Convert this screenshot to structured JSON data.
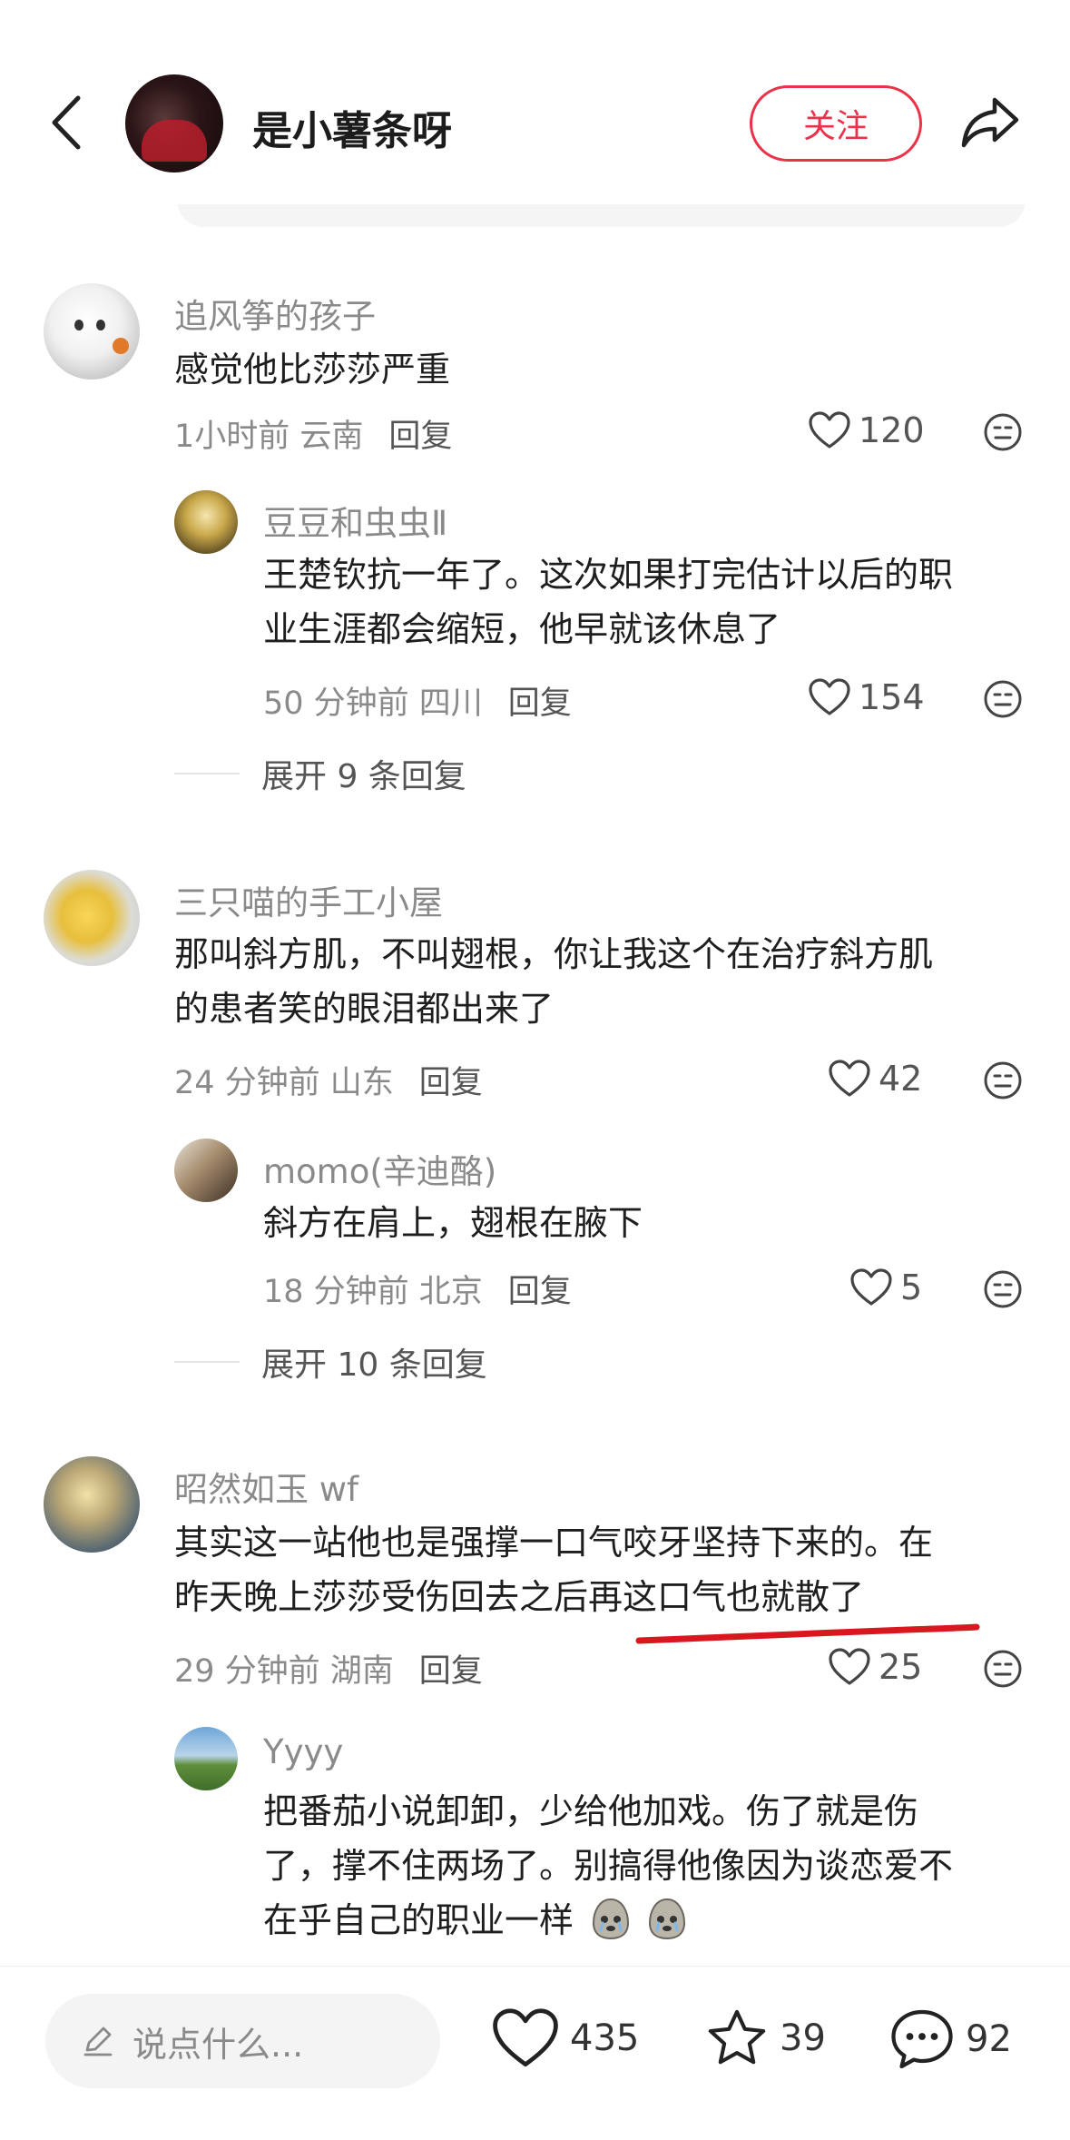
{
  "header": {
    "username": "是小薯条呀",
    "follow_label": "关注"
  },
  "comments": [
    {
      "username": "追风筝的孩子",
      "lines": [
        "感觉他比莎莎严重"
      ],
      "time": "1小时前 云南",
      "reply_label": "回复",
      "likes": "120",
      "replies": [
        {
          "username": "豆豆和虫虫Ⅱ",
          "lines": [
            "王楚钦抗一年了。这次如果打完估计以后的职",
            "业生涯都会缩短，他早就该休息了"
          ],
          "time": "50 分钟前 四川",
          "reply_label": "回复",
          "likes": "154"
        }
      ],
      "expand_label": "展开 9 条回复"
    },
    {
      "username": "三只喵的手工小屋",
      "lines": [
        "那叫斜方肌，不叫翅根，你让我这个在治疗斜方肌",
        "的患者笑的眼泪都出来了"
      ],
      "time": "24 分钟前 山东",
      "reply_label": "回复",
      "likes": "42",
      "replies": [
        {
          "username": "momo(辛迪酪)",
          "lines": [
            "斜方在肩上，翅根在腋下"
          ],
          "time": "18 分钟前 北京",
          "reply_label": "回复",
          "likes": "5"
        }
      ],
      "expand_label": "展开 10 条回复"
    },
    {
      "username": "昭然如玉 wf",
      "lines": [
        "其实这一站他也是强撑一口气咬牙坚持下来的。在",
        "昨天晚上莎莎受伤回去之后再这口气也就散了"
      ],
      "time": "29 分钟前 湖南",
      "reply_label": "回复",
      "likes": "25",
      "replies": [
        {
          "username": "Yyyy",
          "lines": [
            "把番茄小说卸卸，少给他加戏。伤了就是伤",
            "了，撑不住两场了。别搞得他像因为谈恋爱不",
            "在乎自己的职业一样"
          ],
          "time": "",
          "reply_label": "",
          "likes": ""
        }
      ]
    }
  ],
  "bottom_bar": {
    "input_placeholder": "说点什么...",
    "likes": "435",
    "stars": "39",
    "comments": "92"
  },
  "icons": {
    "back": "chevron-left-icon",
    "share": "share-arrow-icon",
    "like": "heart-outline-icon",
    "emoji": "emoji-face-icon",
    "edit": "pencil-icon",
    "star": "star-outline-icon",
    "comment": "chat-bubble-icon"
  },
  "colors": {
    "accent": "#e8334a",
    "muted_text": "#8a8a8a",
    "annotation_red": "#d9171f"
  }
}
